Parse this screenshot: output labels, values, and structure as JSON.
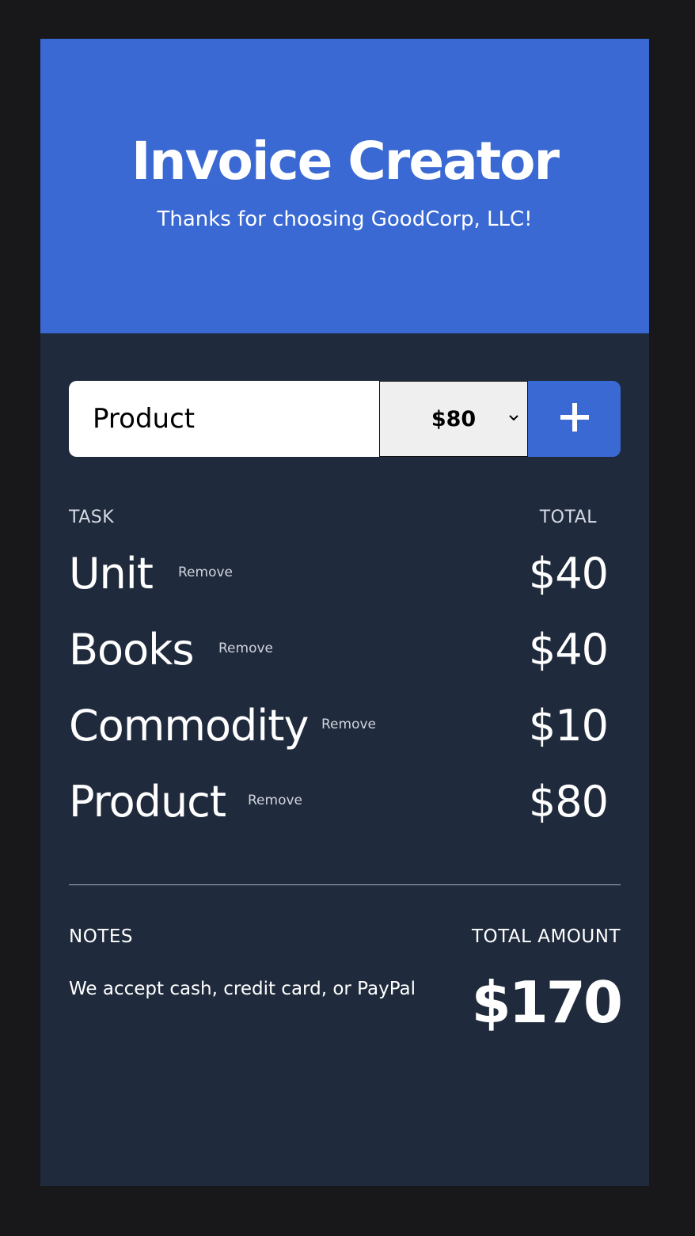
{
  "header": {
    "title": "Invoice Creator",
    "subtitle": "Thanks for choosing GoodCorp, LLC!"
  },
  "entry": {
    "task_value": "Product",
    "price_selected": "$80",
    "add_icon": "plus-icon"
  },
  "table": {
    "task_header": "TASK",
    "total_header": "TOTAL",
    "remove_label": "Remove",
    "rows": [
      {
        "name": "Unit",
        "amount": "$40"
      },
      {
        "name": "Books",
        "amount": "$40"
      },
      {
        "name": "Commodity",
        "amount": "$10"
      },
      {
        "name": "Product",
        "amount": "$80"
      }
    ]
  },
  "footer": {
    "notes_label": "NOTES",
    "notes_text": "We accept cash, credit card, or PayPal",
    "total_label": "TOTAL AMOUNT",
    "total_amount": "$170"
  },
  "colors": {
    "accent": "#3b69d3",
    "panel": "#1f2a3c",
    "background": "#18181a"
  }
}
